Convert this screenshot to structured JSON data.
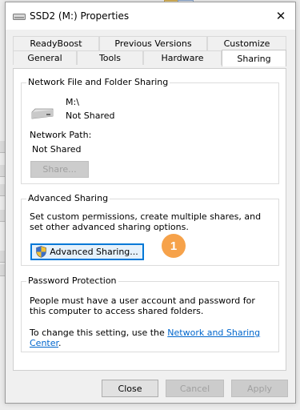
{
  "window": {
    "title": "SSD2 (M:) Properties"
  },
  "tabs_row1": [
    {
      "label": "ReadyBoost"
    },
    {
      "label": "Previous Versions"
    },
    {
      "label": "Customize"
    }
  ],
  "tabs_row2": [
    {
      "label": "General"
    },
    {
      "label": "Tools"
    },
    {
      "label": "Hardware"
    },
    {
      "label": "Sharing",
      "active": true
    }
  ],
  "network_sharing": {
    "title": "Network File and Folder Sharing",
    "drive_path": "M:\\",
    "drive_status": "Not Shared",
    "network_path_label": "Network Path:",
    "network_path_value": "Not Shared",
    "share_button": "Share..."
  },
  "advanced_sharing": {
    "title": "Advanced Sharing",
    "description": "Set custom permissions, create multiple shares, and set other advanced sharing options.",
    "button": "Advanced Sharing..."
  },
  "password_protection": {
    "title": "Password Protection",
    "text1": "People must have a user account and password for this computer to access shared folders.",
    "text2_prefix": "To change this setting, use the ",
    "text2_link": "Network and Sharing Center",
    "text2_suffix": "."
  },
  "callout": {
    "number": "1"
  },
  "footer": {
    "close": "Close",
    "cancel": "Cancel",
    "apply": "Apply"
  },
  "colors": {
    "link": "#0066cc",
    "focus": "#0078d7",
    "badge": "#f6a24a"
  },
  "icons": {
    "title": "drive-icon",
    "close": "close-icon",
    "drive": "drive-icon",
    "shield": "uac-shield-icon"
  }
}
